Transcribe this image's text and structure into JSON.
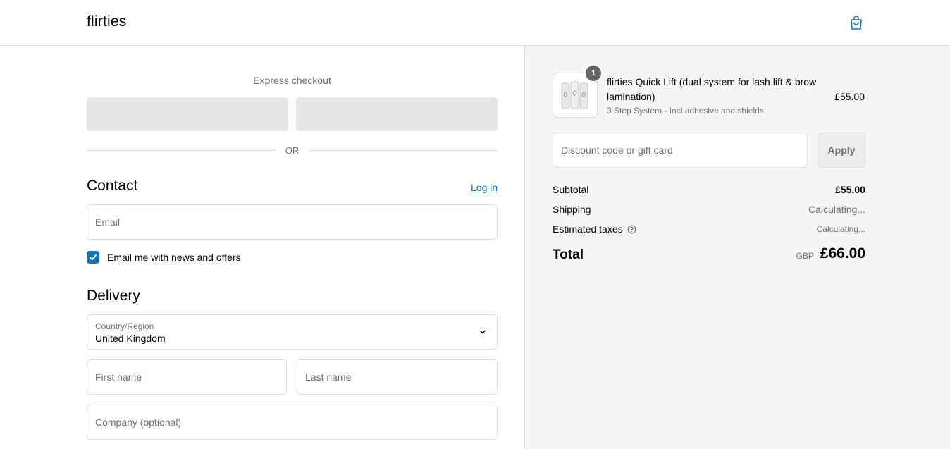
{
  "header": {
    "brand": "flirties",
    "cart_icon": "shopping-bag-icon"
  },
  "express": {
    "title": "Express checkout",
    "or_label": "OR"
  },
  "contact": {
    "title": "Contact",
    "login_label": "Log in",
    "email_placeholder": "Email",
    "news_checkbox_label": "Email me with news and offers",
    "news_checked": true
  },
  "delivery": {
    "title": "Delivery",
    "country_label": "Country/Region",
    "country_value": "United Kingdom",
    "first_name_placeholder": "First name",
    "last_name_placeholder": "Last name",
    "company_placeholder": "Company (optional)"
  },
  "order": {
    "item": {
      "quantity": "1",
      "name": "flirties Quick Lift (dual system for lash lift & brow lamination)",
      "variant": "3 Step System - Incl adhesive and shields",
      "price": "£55.00"
    },
    "discount_placeholder": "Discount code or gift card",
    "apply_label": "Apply",
    "subtotal_label": "Subtotal",
    "subtotal_value": "£55.00",
    "shipping_label": "Shipping",
    "shipping_value": "Calculating...",
    "taxes_label": "Estimated taxes",
    "taxes_value": "Calculating...",
    "total_label": "Total",
    "total_currency": "GBP",
    "total_value": "£66.00"
  },
  "colors": {
    "accent": "#1773b0",
    "muted_text": "#707070",
    "border": "#dedede",
    "summary_bg": "#f5f5f5"
  }
}
